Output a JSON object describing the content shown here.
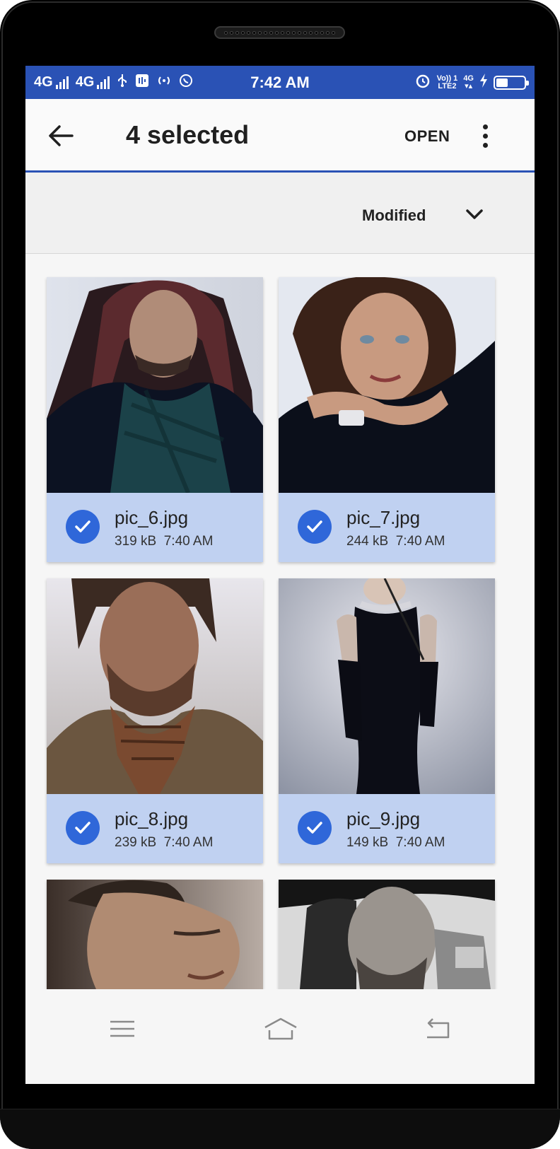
{
  "status_bar": {
    "network_1": "4G",
    "network_2": "4G",
    "time": "7:42 AM",
    "volte_line1": "Vo)) 1",
    "volte_line2": "LTE2",
    "net_small": "4G",
    "battery_level": 0.4
  },
  "app_bar": {
    "title": "4 selected",
    "open_label": "OPEN"
  },
  "sort": {
    "label": "Modified"
  },
  "files": [
    {
      "name": "pic_6.jpg",
      "size": "319 kB",
      "time": "7:40 AM",
      "selected": true
    },
    {
      "name": "pic_7.jpg",
      "size": "244 kB",
      "time": "7:40 AM",
      "selected": true
    },
    {
      "name": "pic_8.jpg",
      "size": "239 kB",
      "time": "7:40 AM",
      "selected": true
    },
    {
      "name": "pic_9.jpg",
      "size": "149 kB",
      "time": "7:40 AM",
      "selected": true
    }
  ],
  "colors": {
    "accent": "#2a52b5",
    "check": "#2f67d9",
    "selected_meta_bg": "#c0d1f1"
  }
}
